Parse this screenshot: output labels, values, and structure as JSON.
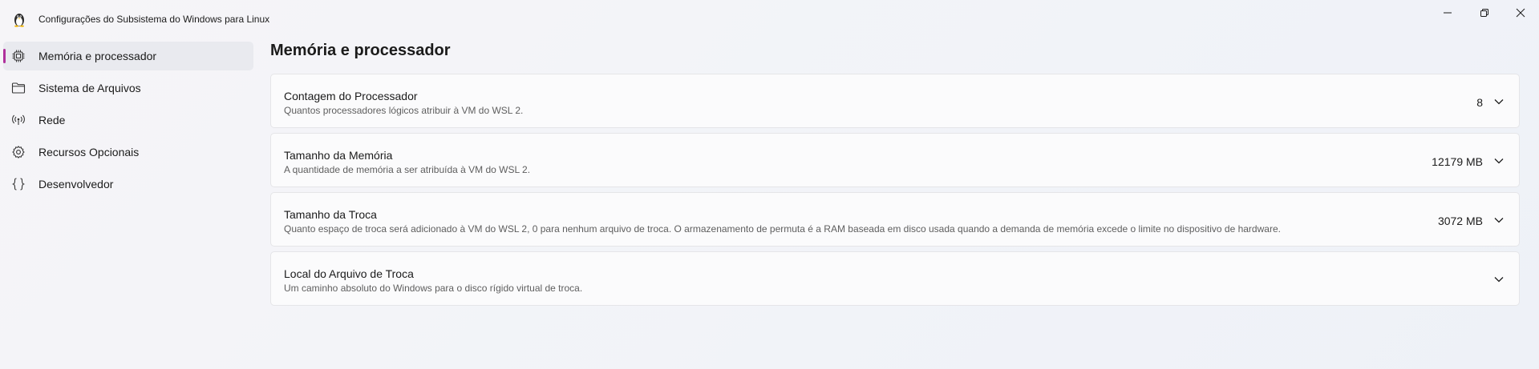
{
  "window": {
    "title": "Configurações do Subsistema do Windows para Linux",
    "app_icon": "tux-penguin-icon",
    "controls": [
      {
        "name": "minimize",
        "icon": "minimize-icon"
      },
      {
        "name": "maximize",
        "icon": "restore-icon"
      },
      {
        "name": "close",
        "icon": "close-icon"
      }
    ]
  },
  "sidebar": {
    "accent_color": "#b0309c",
    "items": [
      {
        "label": "Memória e processador",
        "icon": "processor-chip-icon",
        "selected": true
      },
      {
        "label": "Sistema de Arquivos",
        "icon": "folder-icon",
        "selected": false
      },
      {
        "label": "Rede",
        "icon": "network-antenna-icon",
        "selected": false
      },
      {
        "label": "Recursos Opcionais",
        "icon": "gear-icon",
        "selected": false
      },
      {
        "label": "Desenvolvedor",
        "icon": "curly-braces-icon",
        "selected": false
      }
    ]
  },
  "main": {
    "page_title": "Memória e processador",
    "settings": [
      {
        "title": "Contagem do Processador",
        "description": "Quantos processadores lógicos atribuir à VM do WSL 2.",
        "value": "8"
      },
      {
        "title": "Tamanho da Memória",
        "description": "A quantidade de memória a ser atribuída à VM do WSL 2.",
        "value": "12179 MB"
      },
      {
        "title": "Tamanho da Troca",
        "description": "Quanto espaço de troca será adicionado à VM do WSL 2, 0 para nenhum arquivo de troca. O armazenamento de permuta é a RAM baseada em disco usada quando a demanda de memória excede o limite no dispositivo de hardware.",
        "value": "3072 MB"
      },
      {
        "title": "Local do Arquivo de Troca",
        "description": "Um caminho absoluto do Windows para o disco rígido virtual de troca.",
        "value": ""
      }
    ]
  }
}
